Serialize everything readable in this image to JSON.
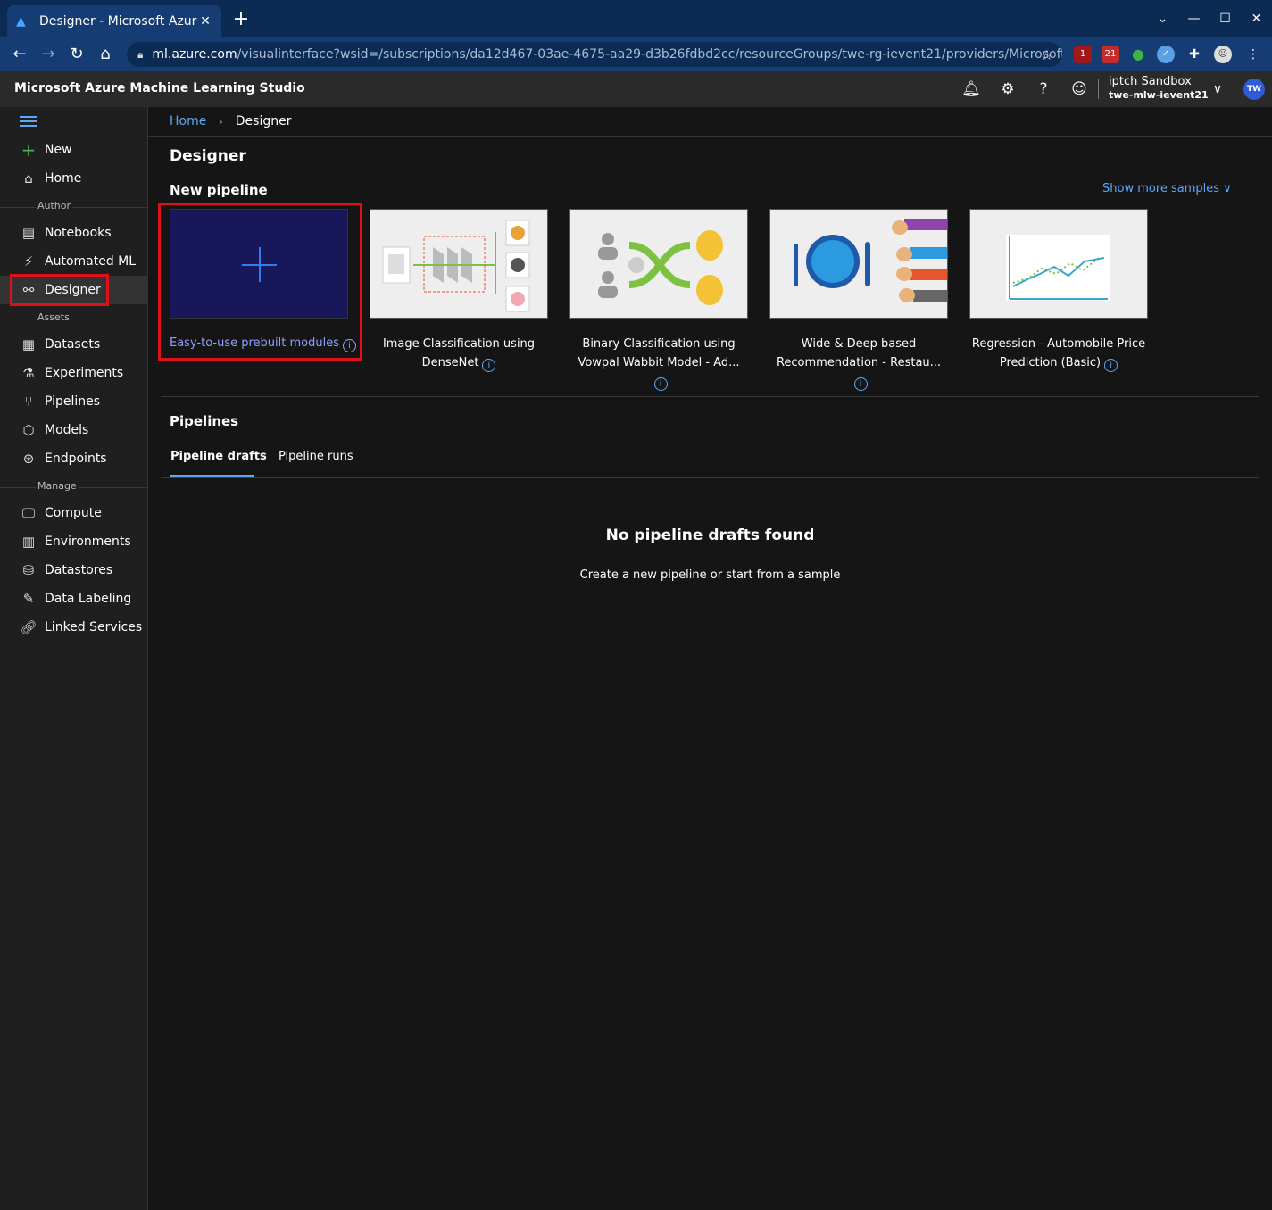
{
  "browser": {
    "tab_title": "Designer - Microsoft Azur",
    "url_host": "ml.azure.com",
    "url_rest": "/visualinterface?wsid=/subscriptions/da12d467-03ae-4675-aa29-d3b26fdbd2cc/resourceGroups/twe-rg-ievent21/providers/Microsoft.Machi...",
    "ext_badges": [
      "1",
      "21"
    ]
  },
  "app": {
    "title": "Microsoft Azure Machine Learning Studio",
    "account_name": "iptch Sandbox",
    "workspace": "twe-mlw-ievent21",
    "avatar_initials": "TW"
  },
  "sidebar": {
    "new": "New",
    "home": "Home",
    "author_label": "Author",
    "notebooks": "Notebooks",
    "automated_ml": "Automated ML",
    "designer": "Designer",
    "assets_label": "Assets",
    "datasets": "Datasets",
    "experiments": "Experiments",
    "pipelines": "Pipelines",
    "models": "Models",
    "endpoints": "Endpoints",
    "manage_label": "Manage",
    "compute": "Compute",
    "environments": "Environments",
    "datastores": "Datastores",
    "data_labeling": "Data Labeling",
    "linked_services": "Linked Services"
  },
  "breadcrumb": {
    "home": "Home",
    "current": "Designer"
  },
  "main": {
    "page_title": "Designer",
    "new_pipeline_title": "New pipeline",
    "show_more": "Show more samples",
    "new_card_caption": "Easy-to-use prebuilt modules",
    "samples": [
      {
        "line1": "Image Classification using",
        "line2": "DenseNet"
      },
      {
        "line1": "Binary Classification using",
        "line2": "Vowpal Wabbit Model - Ad..."
      },
      {
        "line1": "Wide & Deep based",
        "line2": "Recommendation - Restau..."
      },
      {
        "line1": "Regression - Automobile Price",
        "line2": "Prediction (Basic)"
      }
    ],
    "pipelines_title": "Pipelines",
    "tab_drafts": "Pipeline drafts",
    "tab_runs": "Pipeline runs",
    "empty_title": "No pipeline drafts found",
    "empty_sub": "Create a new pipeline or start from a sample"
  },
  "colors": {
    "accent": "#5da8f5",
    "highlight": "#e0101a",
    "new_card_bg": "#17175a"
  }
}
